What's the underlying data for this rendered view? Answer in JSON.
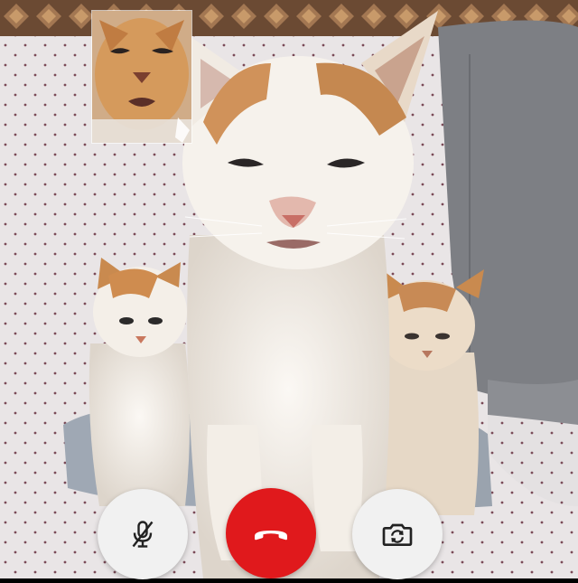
{
  "call": {
    "remote_feed": "video-feed",
    "self_preview": "self-view-feed"
  },
  "controls": [
    {
      "id": "mute",
      "icon": "mic-off-icon",
      "color": "#f1f1f1"
    },
    {
      "id": "end_call",
      "icon": "phone-hangup-icon",
      "color": "#e0191c"
    },
    {
      "id": "switch_camera",
      "icon": "camera-switch-icon",
      "color": "#f1f1f1"
    }
  ],
  "colors": {
    "end_call_red": "#e0191c",
    "control_light": "#f1f1f1",
    "icon_dark": "#222222"
  }
}
